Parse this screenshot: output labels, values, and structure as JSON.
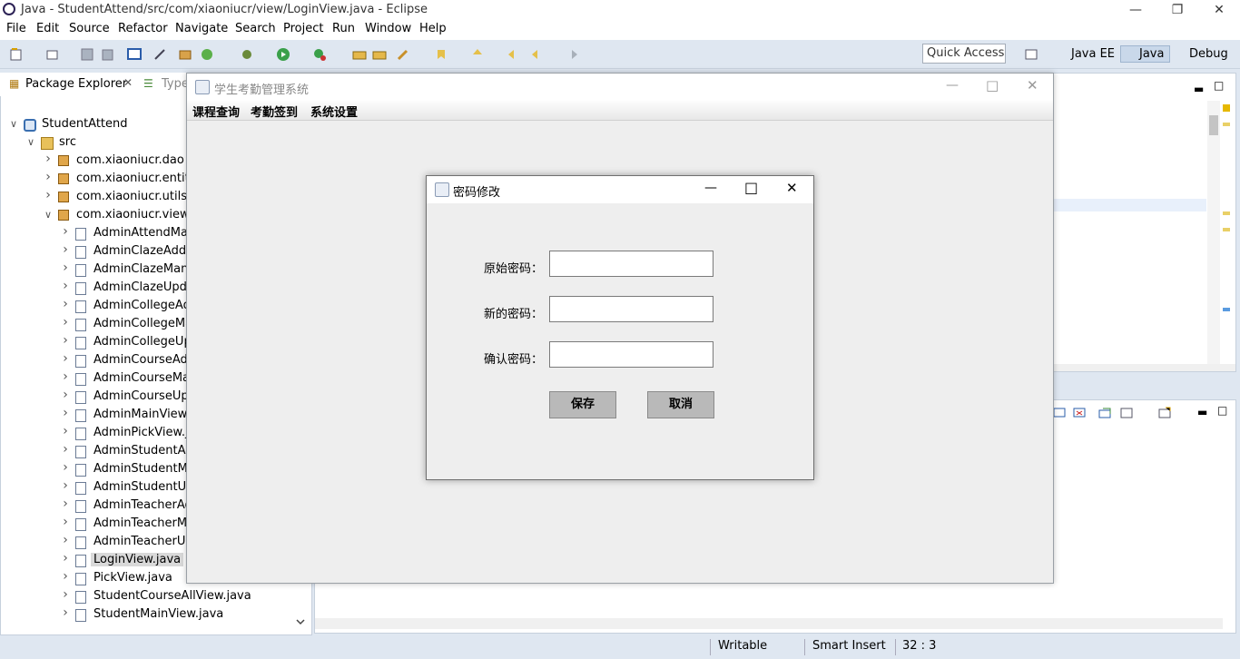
{
  "window": {
    "title": "Java - StudentAttend/src/com/xiaoniucr/view/LoginView.java - Eclipse"
  },
  "menu": [
    "File",
    "Edit",
    "Source",
    "Refactor",
    "Navigate",
    "Search",
    "Project",
    "Run",
    "Window",
    "Help"
  ],
  "toolbar": {
    "quick_access_placeholder": "Quick Access",
    "perspectives": [
      "Java EE",
      "Java",
      "Debug"
    ]
  },
  "package_explorer": {
    "tab_label": "Package Explorer",
    "second_tab_label": "Type",
    "tree": [
      {
        "label": "StudentAttend",
        "level": 0,
        "expanded": true,
        "kind": "project"
      },
      {
        "label": "src",
        "level": 1,
        "expanded": true,
        "kind": "folder"
      },
      {
        "label": "com.xiaoniucr.dao",
        "level": 2,
        "expanded": false,
        "kind": "package"
      },
      {
        "label": "com.xiaoniucr.entity",
        "level": 2,
        "expanded": false,
        "kind": "package"
      },
      {
        "label": "com.xiaoniucr.utils",
        "level": 2,
        "expanded": false,
        "kind": "package"
      },
      {
        "label": "com.xiaoniucr.view",
        "level": 2,
        "expanded": true,
        "kind": "package"
      },
      {
        "label": "AdminAttendMan",
        "level": 3,
        "expanded": false,
        "kind": "java"
      },
      {
        "label": "AdminClazeAddV",
        "level": 3,
        "expanded": false,
        "kind": "java"
      },
      {
        "label": "AdminClazeMana",
        "level": 3,
        "expanded": false,
        "kind": "java"
      },
      {
        "label": "AdminClazeUpda",
        "level": 3,
        "expanded": false,
        "kind": "java"
      },
      {
        "label": "AdminCollegeAdc",
        "level": 3,
        "expanded": false,
        "kind": "java"
      },
      {
        "label": "AdminCollegeMa",
        "level": 3,
        "expanded": false,
        "kind": "java"
      },
      {
        "label": "AdminCollegeUpc",
        "level": 3,
        "expanded": false,
        "kind": "java"
      },
      {
        "label": "AdminCourseAdd",
        "level": 3,
        "expanded": false,
        "kind": "java"
      },
      {
        "label": "AdminCourseMar",
        "level": 3,
        "expanded": false,
        "kind": "java"
      },
      {
        "label": "AdminCourseUpc",
        "level": 3,
        "expanded": false,
        "kind": "java"
      },
      {
        "label": "AdminMainView.j",
        "level": 3,
        "expanded": false,
        "kind": "java"
      },
      {
        "label": "AdminPickView.ja",
        "level": 3,
        "expanded": false,
        "kind": "java"
      },
      {
        "label": "AdminStudentAdc",
        "level": 3,
        "expanded": false,
        "kind": "java"
      },
      {
        "label": "AdminStudentMa",
        "level": 3,
        "expanded": false,
        "kind": "java"
      },
      {
        "label": "AdminStudentUpc",
        "level": 3,
        "expanded": false,
        "kind": "java"
      },
      {
        "label": "AdminTeacherAd",
        "level": 3,
        "expanded": false,
        "kind": "java"
      },
      {
        "label": "AdminTeacherMa",
        "level": 3,
        "expanded": false,
        "kind": "java"
      },
      {
        "label": "AdminTeacherUp",
        "level": 3,
        "expanded": false,
        "kind": "java"
      },
      {
        "label": "LoginView.java",
        "level": 3,
        "expanded": false,
        "kind": "java",
        "selected": true
      },
      {
        "label": "PickView.java",
        "level": 3,
        "expanded": false,
        "kind": "java"
      },
      {
        "label": "StudentCourseAllView.java",
        "level": 3,
        "expanded": false,
        "kind": "java"
      },
      {
        "label": "StudentMainView.java",
        "level": 3,
        "expanded": false,
        "kind": "java"
      }
    ]
  },
  "app_frame": {
    "title": "学生考勤管理系统",
    "menu": [
      "课程查询",
      "考勤签到",
      "系统设置"
    ]
  },
  "dialog": {
    "title": "密码修改",
    "fields": [
      {
        "label": "原始密码：",
        "value": ""
      },
      {
        "label": "新的密码：",
        "value": ""
      },
      {
        "label": "确认密码：",
        "value": ""
      }
    ],
    "save_label": "保存",
    "cancel_label": "取消"
  },
  "status": {
    "writable": "Writable",
    "insert_mode": "Smart Insert",
    "position": "32 : 3"
  },
  "colors": {
    "eclipse_chrome": "#dfe7f1",
    "swing_bg": "#eeeeee",
    "button_bg": "#b9b9b9",
    "selection": "#d9d9d9"
  }
}
